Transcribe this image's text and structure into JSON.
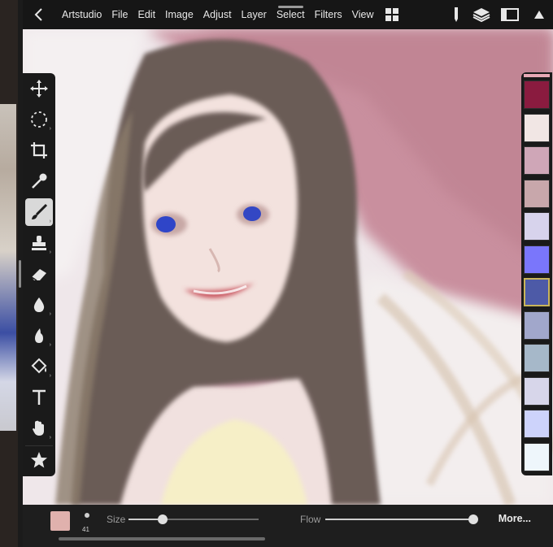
{
  "app": {
    "back_icon": "chevron-left-icon",
    "name": "Artstudio"
  },
  "menu": [
    "File",
    "Edit",
    "Image",
    "Adjust",
    "Layer",
    "Select",
    "Filters",
    "View"
  ],
  "top_icons": [
    "grid-icon",
    "pencil-icon",
    "layers-icon",
    "window-icon",
    "triangle-up-icon"
  ],
  "tools": [
    {
      "name": "move-tool",
      "icon": "move-icon"
    },
    {
      "name": "select-tool",
      "icon": "lasso-icon"
    },
    {
      "name": "crop-tool",
      "icon": "crop-icon"
    },
    {
      "name": "eyedropper-tool",
      "icon": "eyedropper-icon"
    },
    {
      "name": "brush-tool",
      "icon": "brush-icon",
      "selected": true
    },
    {
      "name": "stamp-tool",
      "icon": "stamp-icon"
    },
    {
      "name": "eraser-tool",
      "icon": "eraser-icon"
    },
    {
      "name": "smudge-tool",
      "icon": "drop-icon"
    },
    {
      "name": "burn-tool",
      "icon": "flame-drop-icon"
    },
    {
      "name": "fill-tool",
      "icon": "bucket-icon"
    },
    {
      "name": "text-tool",
      "icon": "text-icon"
    },
    {
      "name": "hand-tool",
      "icon": "hand-icon"
    },
    {
      "name": "favorites-tool",
      "icon": "star-icon"
    }
  ],
  "palette": {
    "top_strip": "#e7a9b6",
    "swatches": [
      "#8a1b3f",
      "#f1e6e4",
      "#cfa6b7",
      "#c8a7ab",
      "#d7d3ec",
      "#7a76fb",
      "#4d5aa7",
      "#a1a7cb",
      "#a6b8c9",
      "#d7d6ea",
      "#cdd3fb",
      "#eef6fb"
    ],
    "current_index": 6
  },
  "bottom": {
    "current_color": "#e0b1ad",
    "brush_size": "41",
    "size_label": "Size",
    "size_value": 0.26,
    "flow_label": "Flow",
    "flow_value": 1.0,
    "more_label": "More..."
  }
}
